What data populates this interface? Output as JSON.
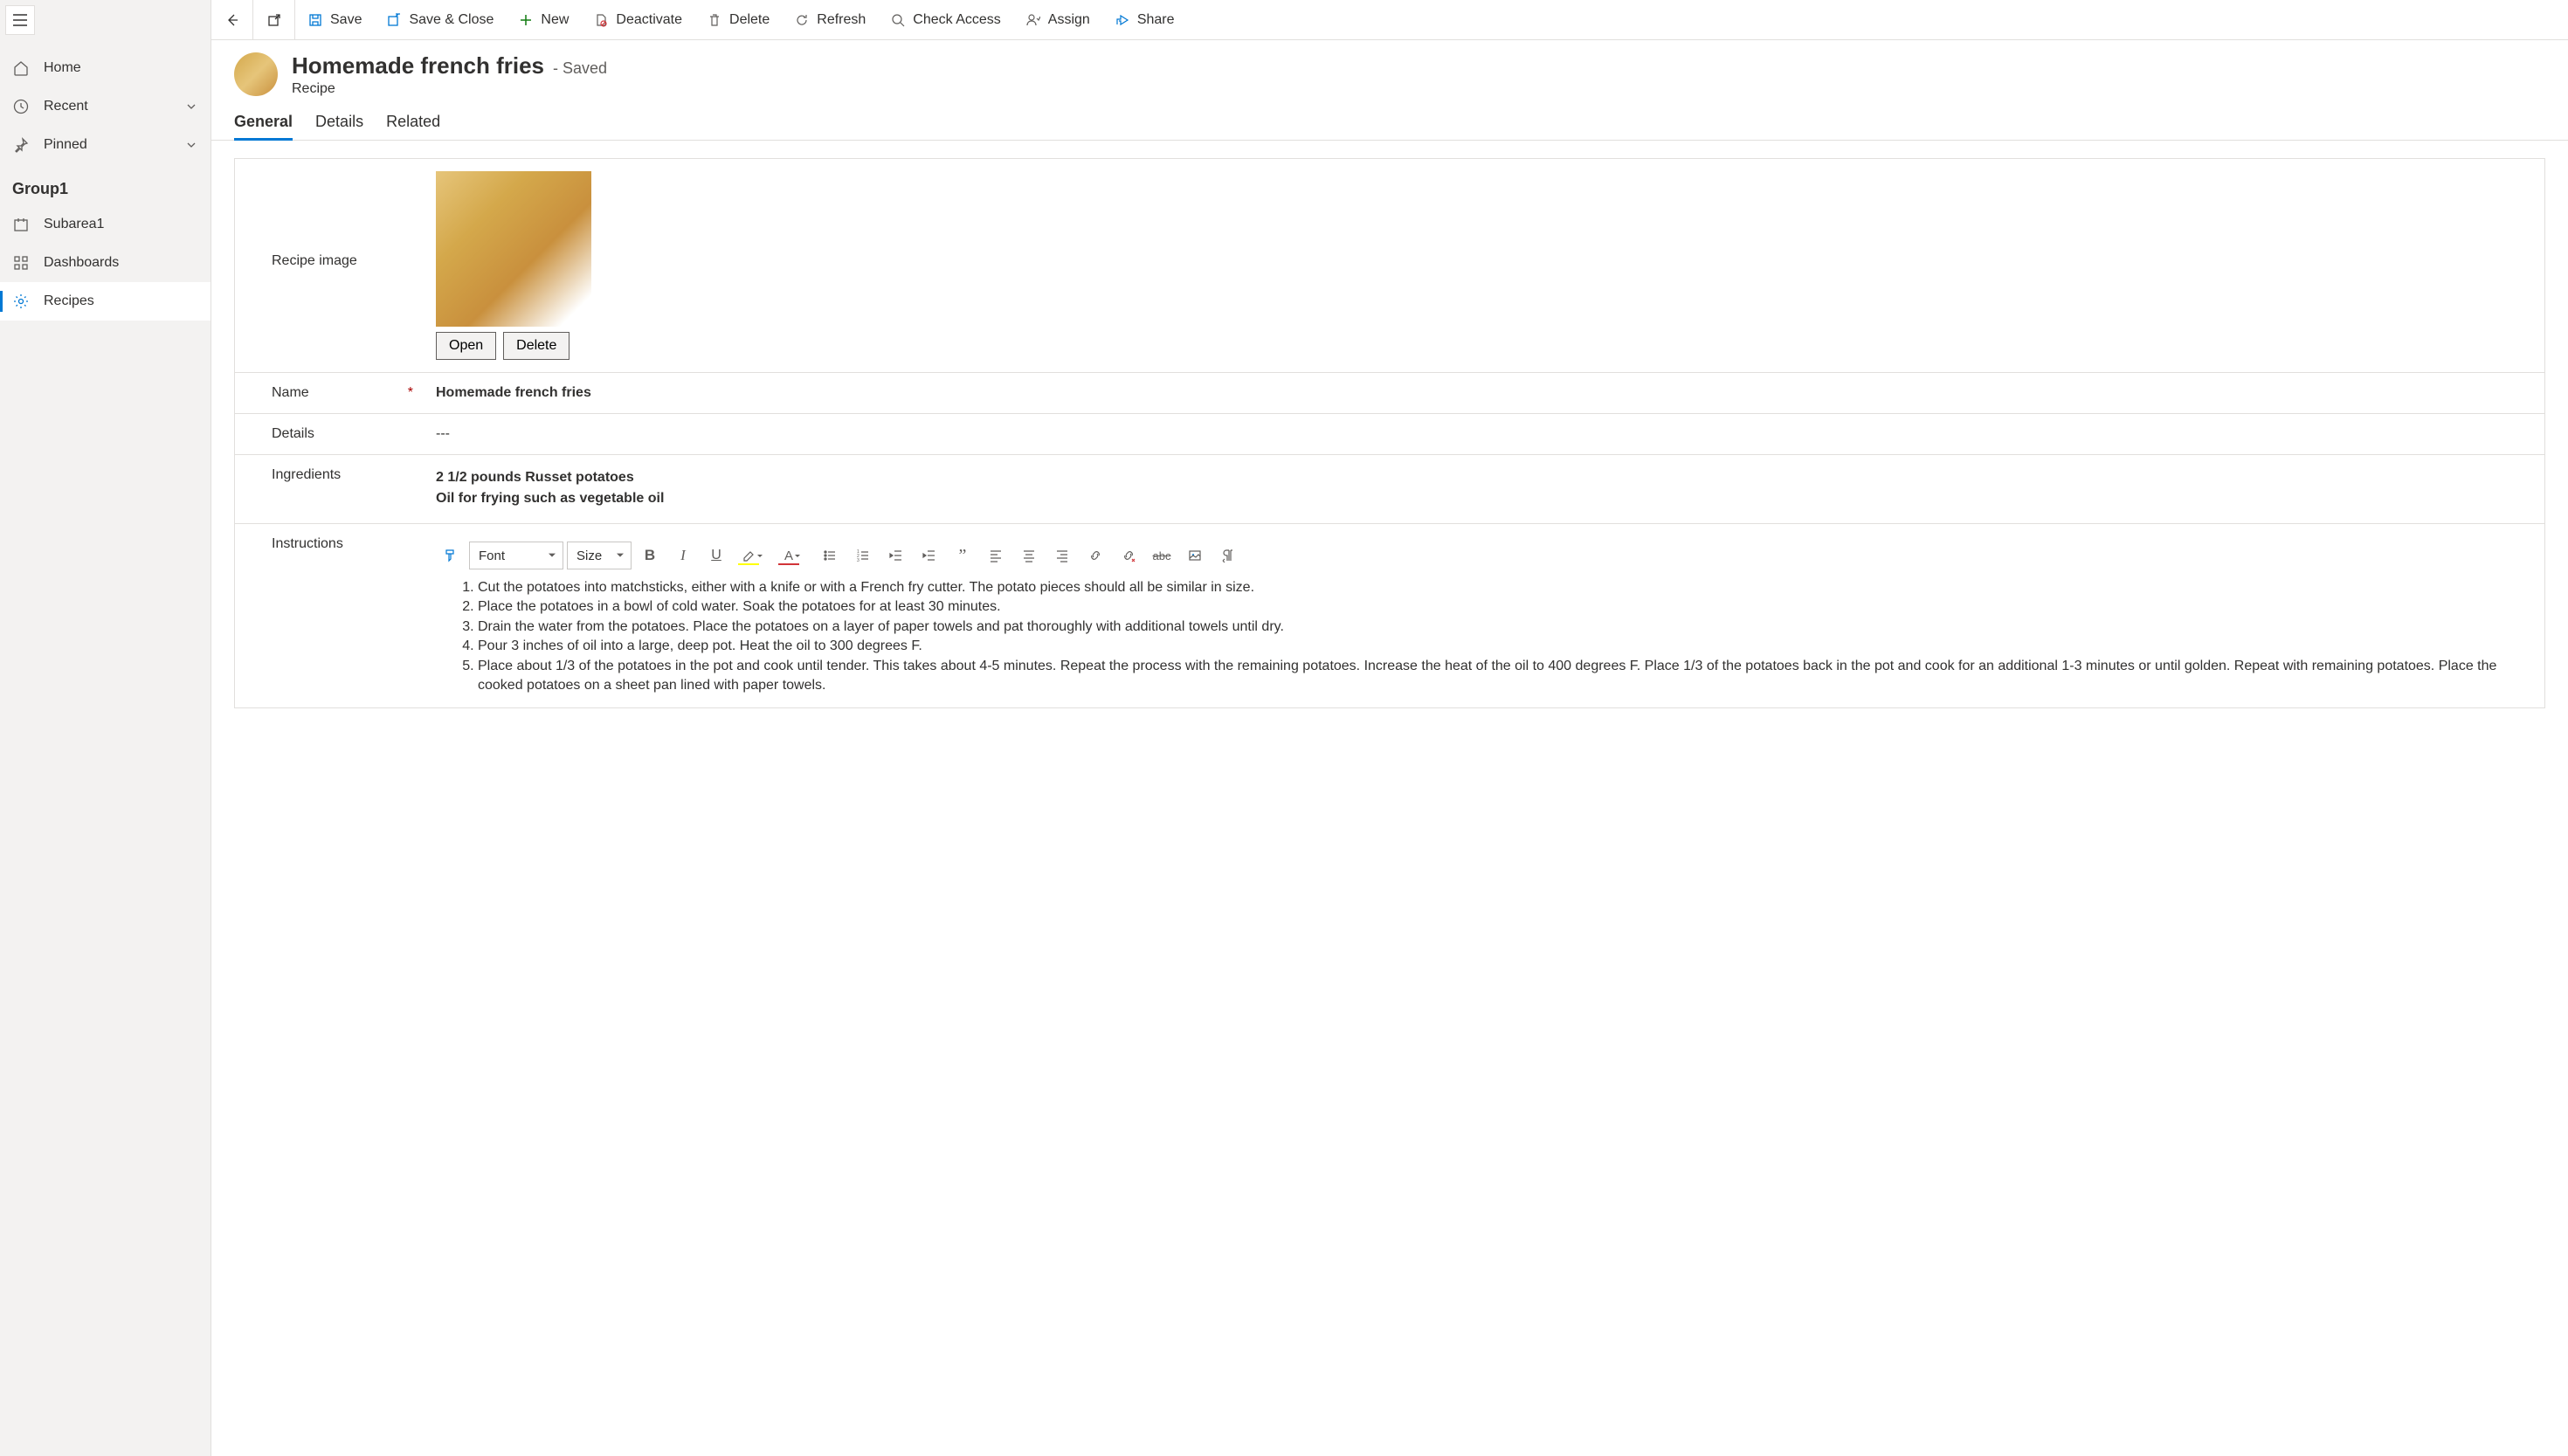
{
  "sidebar": {
    "home": "Home",
    "recent": "Recent",
    "pinned": "Pinned",
    "group_header": "Group1",
    "items": [
      {
        "label": "Subarea1"
      },
      {
        "label": "Dashboards"
      },
      {
        "label": "Recipes"
      }
    ]
  },
  "commands": {
    "save": "Save",
    "save_close": "Save & Close",
    "new": "New",
    "deactivate": "Deactivate",
    "delete": "Delete",
    "refresh": "Refresh",
    "check_access": "Check Access",
    "assign": "Assign",
    "share": "Share"
  },
  "header": {
    "title": "Homemade french fries",
    "status": "- Saved",
    "subtitle": "Recipe"
  },
  "tabs": {
    "general": "General",
    "details": "Details",
    "related": "Related"
  },
  "form": {
    "recipe_image_label": "Recipe image",
    "open_btn": "Open",
    "delete_btn": "Delete",
    "name_label": "Name",
    "name_value": "Homemade french fries",
    "details_label": "Details",
    "details_value": "---",
    "ingredients_label": "Ingredients",
    "ingredients_line1": "2 1/2 pounds Russet potatoes",
    "ingredients_line2": "Oil for frying such as vegetable oil",
    "instructions_label": "Instructions",
    "instructions": [
      "Cut the potatoes into matchsticks, either with a knife or with a French fry cutter. The potato pieces should all be similar in size.",
      "Place the potatoes in a bowl of cold water. Soak the potatoes for at least 30 minutes.",
      "Drain the water from the potatoes. Place the potatoes on a layer of paper towels and pat thoroughly with additional towels until dry.",
      "Pour 3 inches of oil into a large, deep pot. Heat the oil to 300 degrees F.",
      "Place about 1/3 of the potatoes in the pot and cook until tender. This takes about 4-5 minutes. Repeat the process with the remaining potatoes. Increase the heat of the oil to 400 degrees F. Place 1/3 of the potatoes back in the pot and cook for an additional 1-3 minutes or until golden. Repeat with remaining potatoes. Place the cooked potatoes on a sheet pan lined with paper towels."
    ]
  },
  "rte": {
    "font_placeholder": "Font",
    "size_placeholder": "Size"
  }
}
